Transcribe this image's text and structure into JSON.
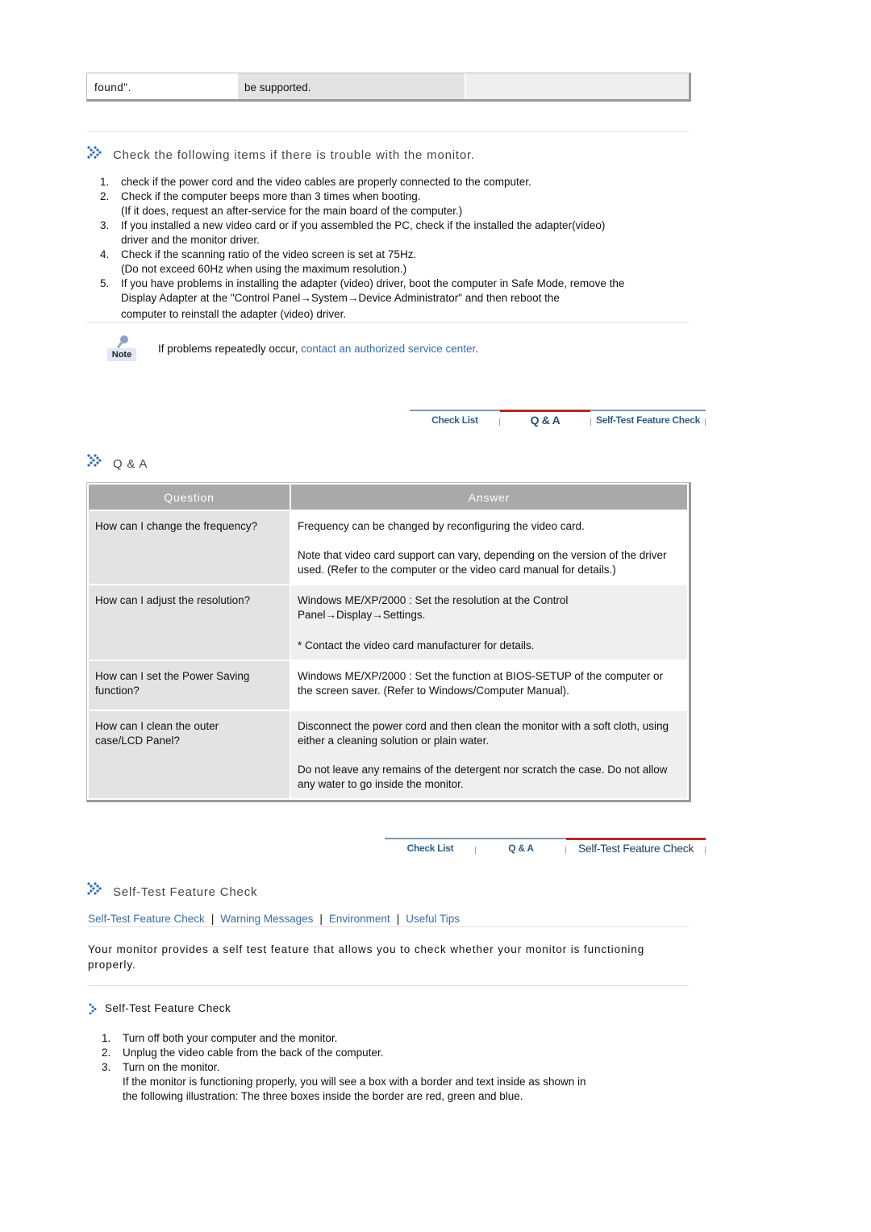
{
  "top_table": {
    "cells": [
      "found\".",
      "be supported.",
      ""
    ]
  },
  "section_trouble": {
    "icon": "double-chevron-icon",
    "title": "Check the following items if there is trouble with the monitor.",
    "steps": [
      {
        "num": "1.",
        "lines": [
          "check if the power cord and the video cables are properly connected to the computer."
        ]
      },
      {
        "num": "2.",
        "lines": [
          "Check if the computer beeps more than 3 times when booting.",
          "(If it does, request an after-service for the main board of the computer.)"
        ]
      },
      {
        "num": "3.",
        "lines": [
          "If you installed a new video card or if you assembled the PC, check if the installed the adapter(video)",
          "driver and the monitor driver."
        ]
      },
      {
        "num": "4.",
        "lines": [
          "Check if the scanning ratio of the video screen is set at 75Hz.",
          "(Do not exceed 60Hz when using the maximum resolution.)"
        ]
      },
      {
        "num": "5.",
        "lines": [
          "If you have problems in installing the adapter (video) driver, boot the computer in Safe Mode, remove the",
          "Display Adapter at the \"Control Panel→System→Device Administrator\" and then reboot the",
          "computer to reinstall the adapter (video) driver."
        ]
      }
    ],
    "note": {
      "icon_label": "Note",
      "text_before": "If problems repeatedly occur, ",
      "link": "contact an authorized service center",
      "text_after": "."
    }
  },
  "tabstrip_1": {
    "tabs": [
      {
        "label": "Check List",
        "active": false
      },
      {
        "label": "Q & A",
        "active": true
      },
      {
        "label": "Self-Test Feature Check",
        "active": false
      }
    ]
  },
  "section_qa": {
    "title": "Q & A",
    "headers": [
      "Question",
      "Answer"
    ],
    "rows": [
      {
        "question": "How can I change the frequency?",
        "answer": [
          "Frequency can be changed by reconfiguring the video card.",
          "Note that video card support can vary, depending on the version of the driver used. (Refer to the computer or the video card manual for details.)"
        ]
      },
      {
        "question": "How can I adjust the resolution?",
        "answer": [
          "Windows ME/XP/2000 : Set the resolution at the Control Panel→Display→Settings.",
          "* Contact the video card manufacturer for details."
        ]
      },
      {
        "question": "How can I set the Power Saving function?",
        "answer": [
          "Windows ME/XP/2000 : Set the function at BIOS-SETUP of the computer or the screen saver. (Refer to Windows/Computer Manual)."
        ]
      },
      {
        "question": "How can I clean the outer case/LCD Panel?",
        "answer": [
          "Disconnect the power cord and then clean the monitor with a soft cloth, using either a cleaning solution or plain water.",
          "Do not leave any remains of the detergent nor scratch the case. Do not allow any water to go inside the monitor."
        ]
      }
    ]
  },
  "tabstrip_2": {
    "tabs": [
      {
        "label": "Check List",
        "active": false
      },
      {
        "label": "Q & A",
        "active": false
      },
      {
        "label": "Self-Test Feature Check",
        "active": true
      }
    ]
  },
  "section_selftest": {
    "title": "Self-Test Feature Check",
    "links": [
      "Self-Test Feature Check",
      "Warning Messages",
      "Environment",
      "Useful Tips"
    ],
    "intro": "Your monitor provides a self test feature that allows you to check whether your monitor is functioning properly.",
    "subheading": "Self-Test Feature Check",
    "steps": [
      {
        "num": "1.",
        "lines": [
          "Turn off both your computer and the monitor."
        ]
      },
      {
        "num": "2.",
        "lines": [
          "Unplug the video cable from the back of the computer."
        ]
      },
      {
        "num": "3.",
        "lines": [
          "Turn on the monitor.",
          "If the monitor is functioning properly, you will see a box with a border and text inside as shown in",
          "the following illustration: The three boxes inside the border are red, green and blue."
        ]
      }
    ]
  },
  "colors": {
    "link": "#3a6ea8",
    "active_tab_line": "#b22a2a",
    "tab_line": "#7d98ad",
    "table_header": "#a9a9a9",
    "icon_blue": "#2b6cb8"
  }
}
